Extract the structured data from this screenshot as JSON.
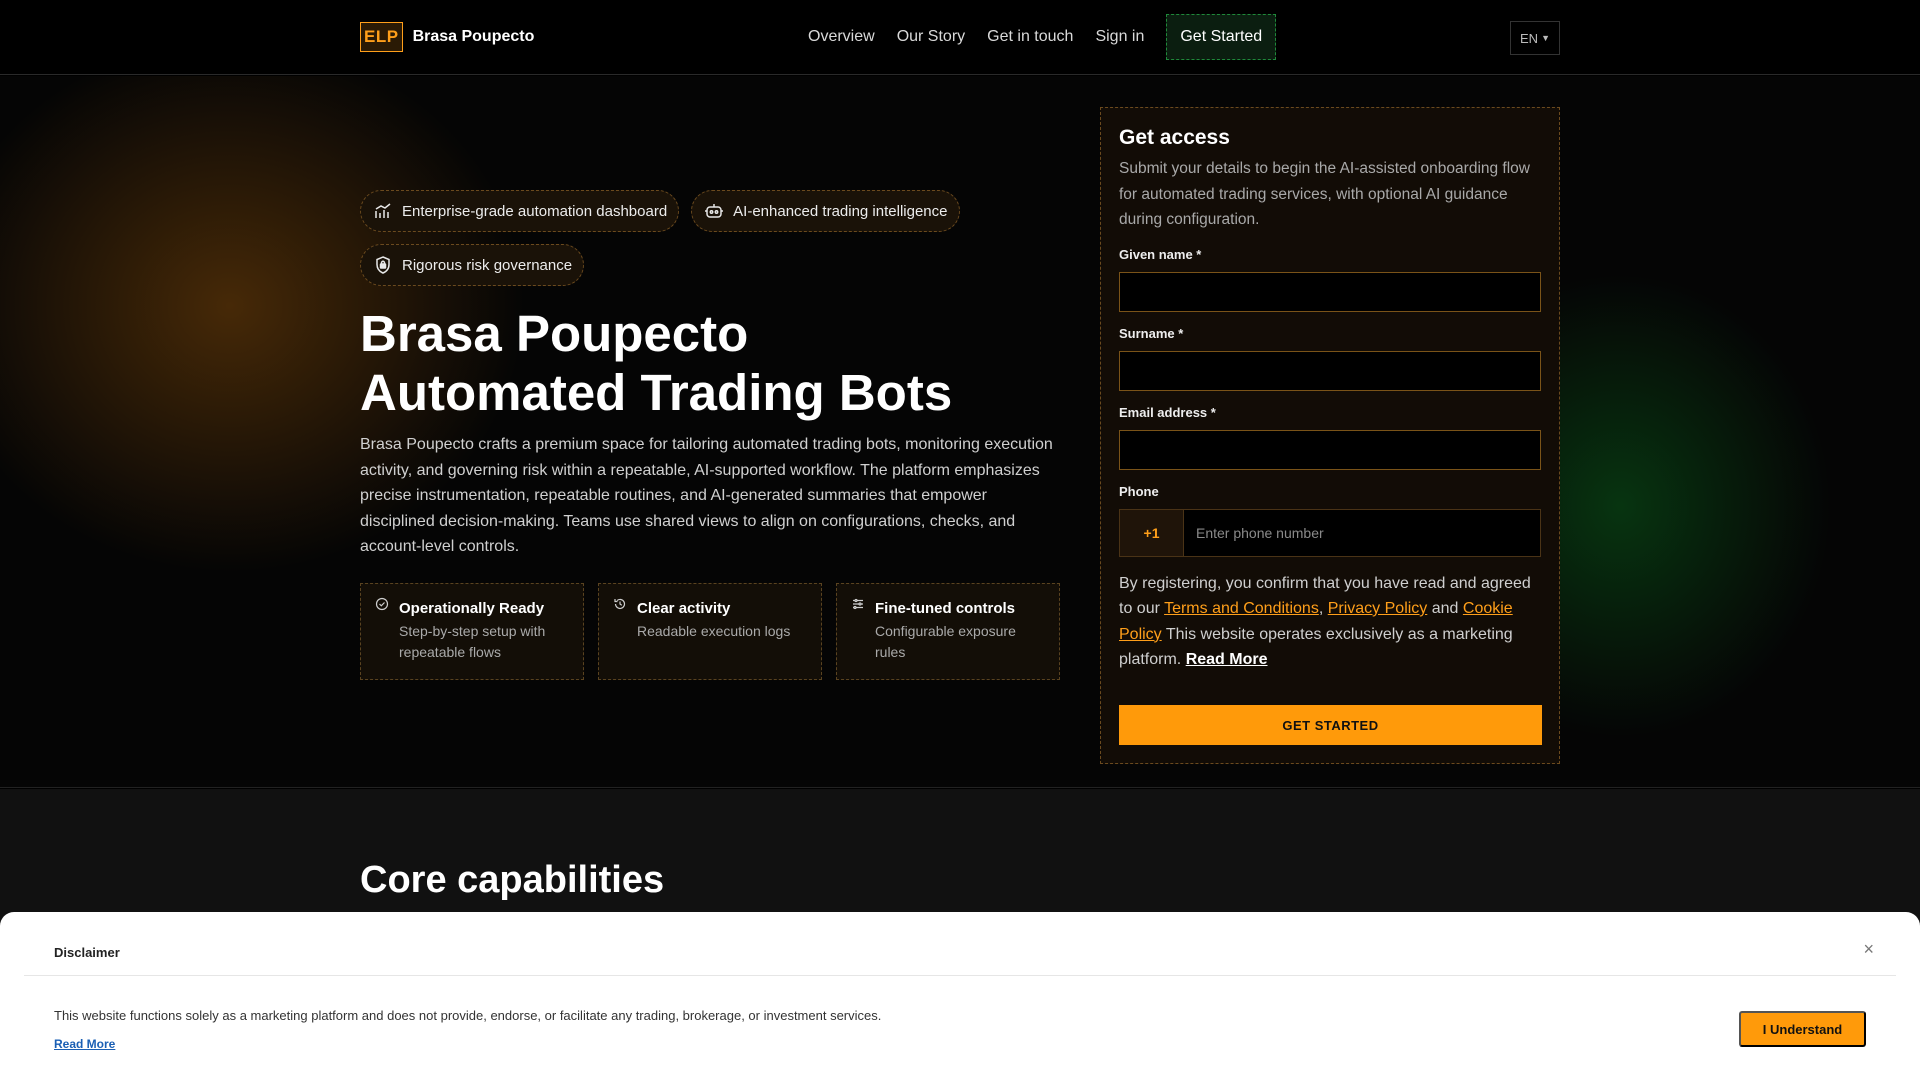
{
  "header": {
    "logo_badge": "ELP",
    "brand": "Brasa Poupecto",
    "nav": [
      {
        "label": "Overview"
      },
      {
        "label": "Our Story"
      },
      {
        "label": "Get in touch"
      },
      {
        "label": "Sign in"
      }
    ],
    "cta": "Get Started",
    "lang": "EN"
  },
  "hero": {
    "chips": [
      {
        "icon": "chart-icon",
        "label": "Enterprise-grade automation dashboard"
      },
      {
        "icon": "robot-icon",
        "label": "AI-enhanced trading intelligence"
      },
      {
        "icon": "shield-icon",
        "label": "Rigorous risk governance"
      }
    ],
    "title_line1": "Brasa Poupecto",
    "title_line2": "Automated Trading Bots",
    "description": "Brasa Poupecto crafts a premium space for tailoring automated trading bots, monitoring execution activity, and governing risk within a repeatable, AI-supported workflow. The platform emphasizes precise instrumentation, repeatable routines, and AI-generated summaries that empower disciplined decision-making. Teams use shared views to align on configurations, checks, and account-level controls.",
    "features": [
      {
        "icon": "check-circle-icon",
        "title": "Operationally Ready",
        "text": "Step-by-step setup with repeatable flows"
      },
      {
        "icon": "history-icon",
        "title": "Clear activity",
        "text": "Readable execution logs"
      },
      {
        "icon": "sliders-icon",
        "title": "Fine-tuned controls",
        "text": "Configurable exposure rules"
      }
    ]
  },
  "form": {
    "title": "Get access",
    "subtitle": "Submit your details to begin the AI-assisted onboarding flow for automated trading services, with optional AI guidance during configuration.",
    "given_name_label": "Given name *",
    "given_name_value": "",
    "surname_label": "Surname *",
    "surname_value": "",
    "email_label": "Email address *",
    "email_value": "",
    "phone_label": "Phone",
    "phone_code": "+1",
    "phone_placeholder": "Enter phone number",
    "consent_prefix": "By registering, you confirm that you have read and agreed to our ",
    "terms": "Terms and Conditions",
    "comma": ", ",
    "privacy": "Privacy Policy",
    "and": " and ",
    "cookie": "Cookie Policy",
    "consent_suffix": " This website operates exclusively as a marketing platform. ",
    "read_more": "Read More",
    "submit": "GET STARTED"
  },
  "section": {
    "title": "Core capabilities"
  },
  "disclaimer": {
    "title": "Disclaimer",
    "close": "×",
    "text": "This website functions solely as a marketing platform and does not provide, endorse, or facilitate any trading, brokerage, or investment services.",
    "read_more": "Read More",
    "button": "I Understand"
  },
  "colors": {
    "accent": "#ff9a0a",
    "green": "#1f8a3a"
  }
}
